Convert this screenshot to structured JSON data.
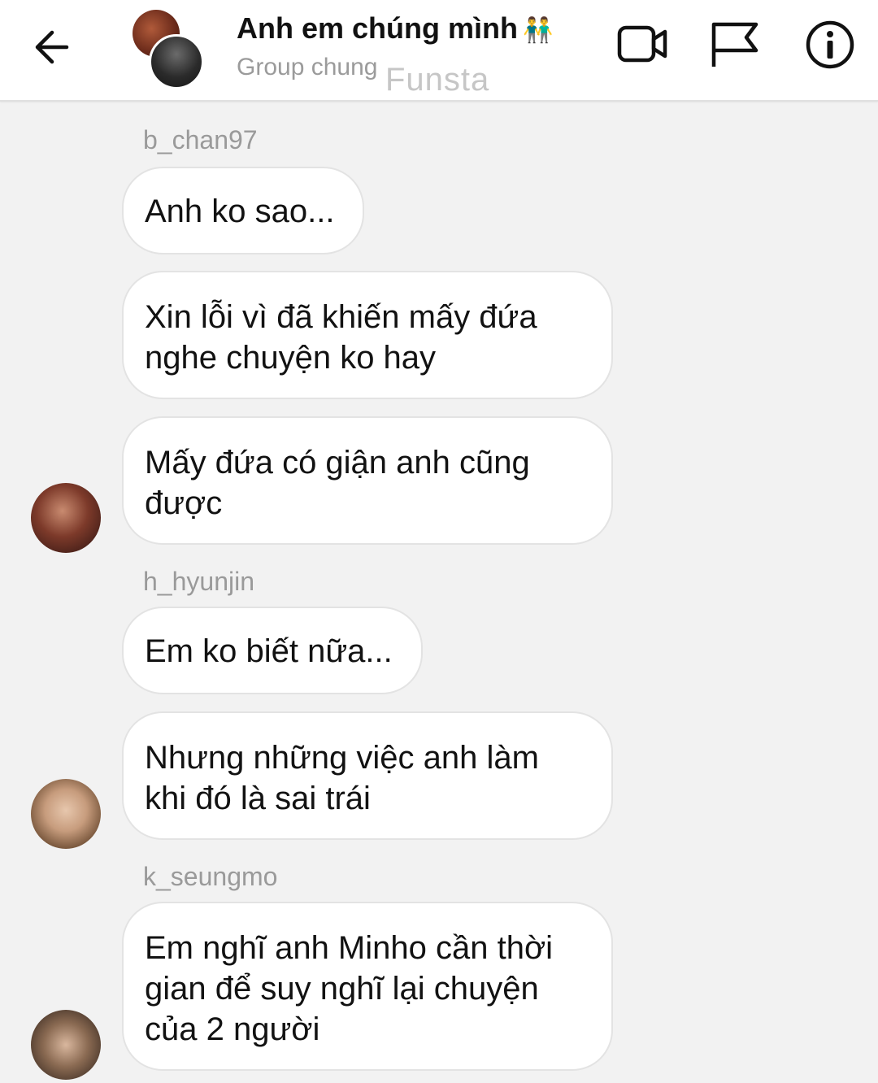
{
  "header": {
    "title": "Anh em chúng mình",
    "title_emoji": "👬",
    "subtitle": "Group chung",
    "watermark": "Funsta"
  },
  "icons": {
    "back": "back-arrow-icon",
    "video": "video-call-icon",
    "flag": "flag-icon",
    "info": "info-icon"
  },
  "messages": [
    {
      "sender": "b_chan97"
    },
    {
      "text": "Anh ko sao..."
    },
    {
      "text_line1": "Xin lỗi vì đã khiến mấy đứa",
      "text_line2": "nghe chuyện ko hay"
    },
    {
      "text_line1": "Mấy đứa có giận anh cũng",
      "text_line2": "được"
    },
    {
      "sender": "h_hyunjin"
    },
    {
      "text": "Em ko biết nữa..."
    },
    {
      "text_line1": "Nhưng những việc anh làm",
      "text_line2": "khi đó là sai trái"
    },
    {
      "sender": "k_seungmo"
    },
    {
      "text_line1": "Em nghĩ anh Minho cần thời",
      "text_line2": "gian để suy nghĩ lại chuyện",
      "text_line3": "của 2 người"
    }
  ],
  "colors": {
    "background": "#f2f2f2",
    "bubble": "#ffffff",
    "bubble_border": "#e3e3e3",
    "sender_text": "#9a9a9a"
  }
}
